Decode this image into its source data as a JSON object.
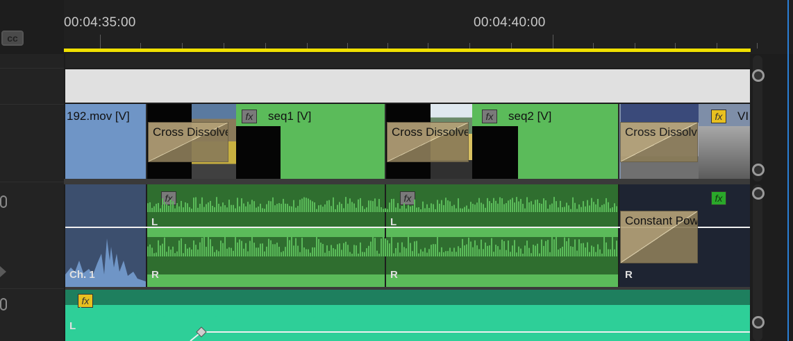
{
  "ruler": {
    "timecode_left": "00:04:35:00",
    "timecode_right": "00:04:40:00"
  },
  "header": {
    "cc_label": "cc"
  },
  "video_track": {
    "clips": [
      {
        "label": "192.mov [V]"
      },
      {
        "label": "seq1 [V]",
        "fx": "fx"
      },
      {
        "label": "seq2 [V]",
        "fx": "fx"
      },
      {
        "label": "VI",
        "fx": "fx"
      }
    ],
    "transitions": [
      "Cross Dissolve",
      "Cross Dissolve",
      "Cross Dissolve"
    ]
  },
  "audio_track_1": {
    "fx_labels": [
      "fx",
      "fx",
      "fx"
    ],
    "channel_labels": {
      "ch1": "Ch. 1",
      "L1": "L",
      "L2": "L",
      "R1": "R",
      "R2": "R",
      "R3": "R"
    },
    "transition": "Constant Power"
  },
  "audio_track_2": {
    "fx": "fx",
    "channel": "L"
  },
  "colors": {
    "clip_blue": "#6f95c6",
    "clip_green": "#5bbb5a",
    "audio_teal": "#2ecf98",
    "playbar": "#f0e000"
  }
}
